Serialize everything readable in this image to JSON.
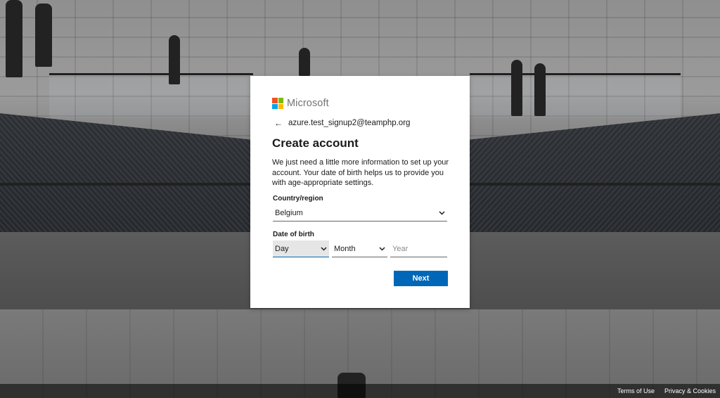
{
  "brand": {
    "name": "Microsoft",
    "logo_colors": [
      "#f25022",
      "#7fba00",
      "#00a4ef",
      "#ffb900"
    ]
  },
  "identity": {
    "back_icon": "arrow-left-icon",
    "email": "azure.test_signup2@teamphp.org"
  },
  "form": {
    "title": "Create account",
    "description": "We just need a little more information to set up your account. Your date of birth helps us to provide you with age-appropriate settings.",
    "country_label": "Country/region",
    "country_value": "Belgium",
    "dob_label": "Date of birth",
    "day_value": "Day",
    "month_value": "Month",
    "year_placeholder": "Year",
    "next_label": "Next"
  },
  "colors": {
    "primary": "#0067b8",
    "text": "#1b1b1b"
  },
  "footer": {
    "terms": "Terms of Use",
    "privacy": "Privacy & Cookies"
  }
}
